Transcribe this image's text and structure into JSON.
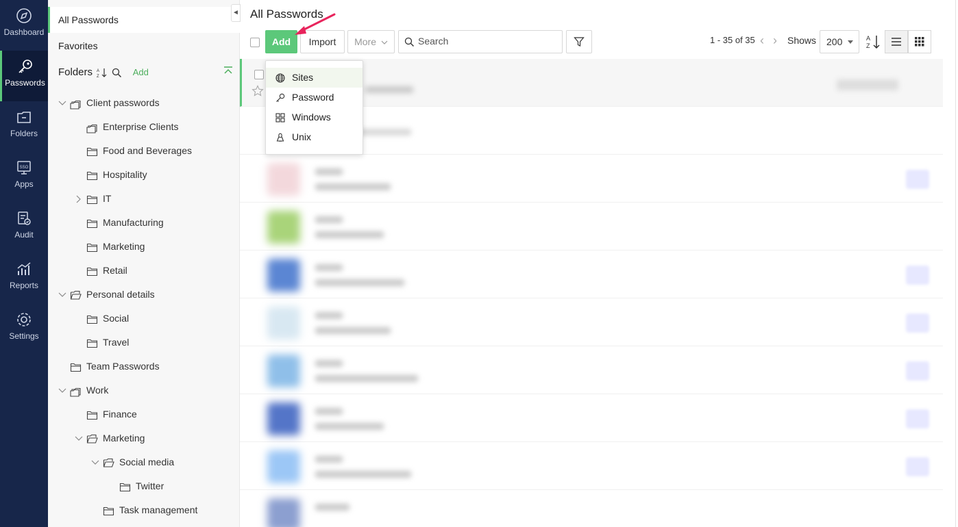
{
  "nav": {
    "items": [
      {
        "label": "Dashboard",
        "icon": "compass-icon"
      },
      {
        "label": "Passwords",
        "icon": "key-icon",
        "active": true
      },
      {
        "label": "Folders",
        "icon": "folder-icon"
      },
      {
        "label": "Apps",
        "icon": "sso-icon"
      },
      {
        "label": "Audit",
        "icon": "audit-icon"
      },
      {
        "label": "Reports",
        "icon": "chart-icon"
      },
      {
        "label": "Settings",
        "icon": "gear-icon"
      }
    ]
  },
  "sidebar": {
    "all_passwords": "All Passwords",
    "favorites": "Favorites",
    "folders_title": "Folders",
    "folders_add": "Add",
    "tree": [
      {
        "label": "Client passwords",
        "expanded": true,
        "shared": true
      },
      {
        "label": "Enterprise Clients",
        "shared": true
      },
      {
        "label": "Food and Beverages"
      },
      {
        "label": "Hospitality"
      },
      {
        "label": "IT",
        "collapsed": true
      },
      {
        "label": "Manufacturing"
      },
      {
        "label": "Marketing"
      },
      {
        "label": "Retail"
      },
      {
        "label": "Personal details",
        "expanded": true
      },
      {
        "label": "Social"
      },
      {
        "label": "Travel"
      },
      {
        "label": "Team Passwords"
      },
      {
        "label": "Work",
        "expanded": true,
        "shared": true
      },
      {
        "label": "Finance"
      },
      {
        "label": "Marketing",
        "expanded": true
      },
      {
        "label": "Social media",
        "expanded": true
      },
      {
        "label": "Twitter"
      },
      {
        "label": "Task management"
      }
    ]
  },
  "main": {
    "title": "All Passwords",
    "toolbar": {
      "add_label": "Add",
      "import_label": "Import",
      "more_label": "More",
      "search_placeholder": "Search"
    },
    "pager": {
      "text": "1 - 35 of 35"
    },
    "shows": {
      "label": "Shows",
      "value": "200"
    },
    "add_menu": [
      {
        "label": "Sites",
        "icon": "globe-icon"
      },
      {
        "label": "Password",
        "icon": "key-icon"
      },
      {
        "label": "Windows",
        "icon": "windows-icon"
      },
      {
        "label": "Unix",
        "icon": "linux-icon"
      }
    ]
  },
  "colors": {
    "rail": "#17264a",
    "accent": "#5cc87a",
    "annotation_arrow": "#e8245c"
  }
}
